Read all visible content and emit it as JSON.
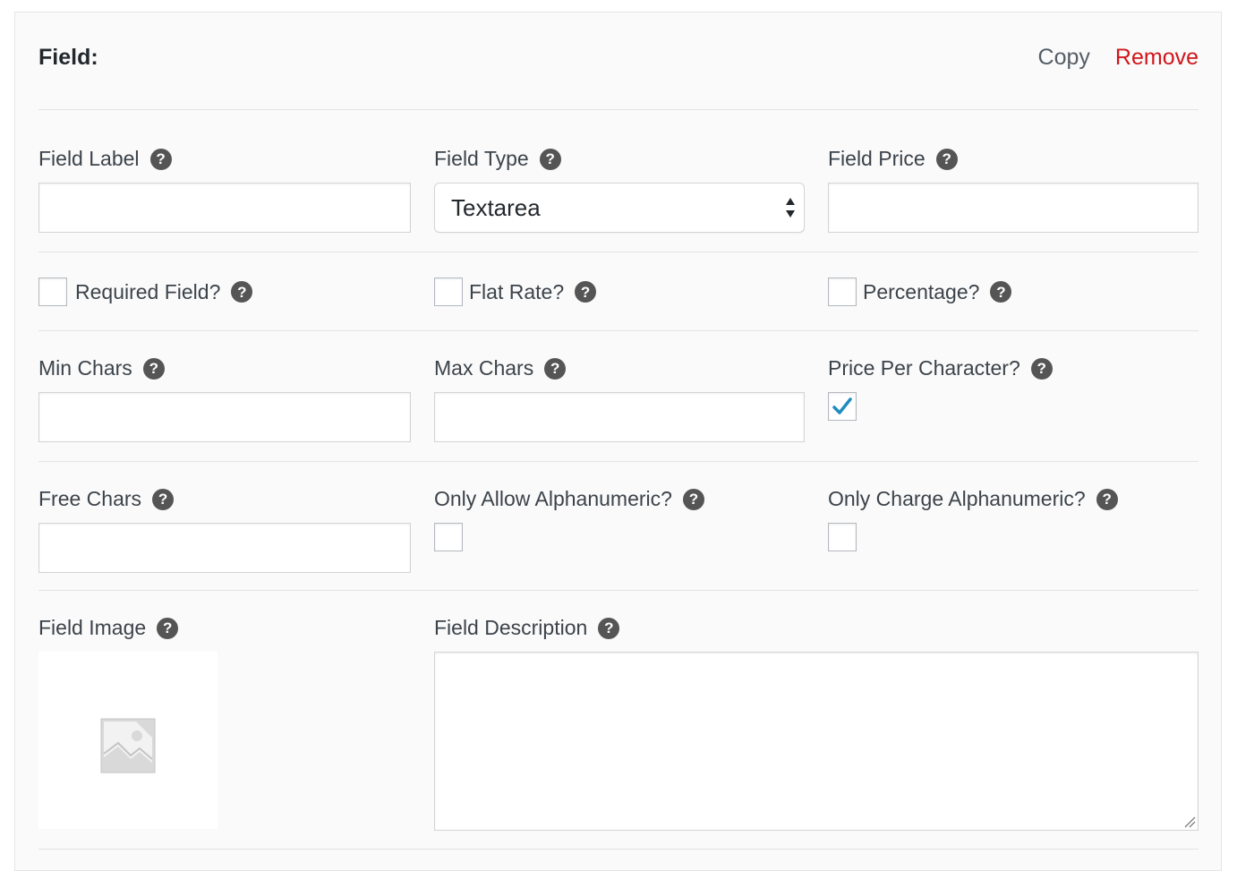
{
  "header": {
    "title": "Field:",
    "copy_label": "Copy",
    "remove_label": "Remove"
  },
  "row1": {
    "field_label": {
      "label": "Field Label",
      "value": ""
    },
    "field_type": {
      "label": "Field Type",
      "value": "Textarea"
    },
    "field_price": {
      "label": "Field Price",
      "value": ""
    }
  },
  "row2": {
    "required": {
      "label": "Required Field?",
      "checked": false
    },
    "flat_rate": {
      "label": "Flat Rate?",
      "checked": false
    },
    "percentage": {
      "label": "Percentage?",
      "checked": false
    }
  },
  "row3": {
    "min_chars": {
      "label": "Min Chars",
      "value": ""
    },
    "max_chars": {
      "label": "Max Chars",
      "value": ""
    },
    "price_per_character": {
      "label": "Price Per Character?",
      "checked": true
    }
  },
  "row4": {
    "free_chars": {
      "label": "Free Chars",
      "value": ""
    },
    "only_allow_alphanumeric": {
      "label": "Only Allow Alphanumeric?",
      "checked": false
    },
    "only_charge_alphanumeric": {
      "label": "Only Charge Alphanumeric?",
      "checked": false
    }
  },
  "row5": {
    "field_image": {
      "label": "Field Image"
    },
    "field_description": {
      "label": "Field Description",
      "value": ""
    }
  },
  "help_glyph": "?",
  "colors": {
    "remove": "#d0161b",
    "checkmark": "#1e8cbe",
    "help_icon": "#555555"
  }
}
